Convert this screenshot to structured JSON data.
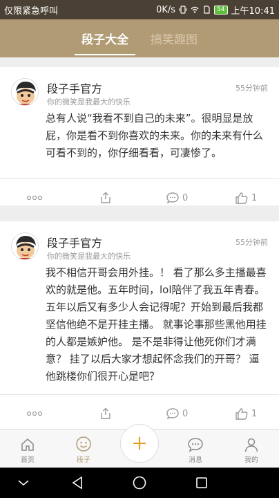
{
  "status_bar": {
    "left_text": "仅限紧急呼叫",
    "speed": "0K/s",
    "battery": "54",
    "time": "上午10:41"
  },
  "header": {
    "tabs": [
      {
        "label": "段子大全",
        "active": true
      },
      {
        "label": "搞笑趣图",
        "active": false
      }
    ]
  },
  "feed": {
    "posts": [
      {
        "author": "段子手官方",
        "motto": "你的微笑是我最大的快乐",
        "time": "55分钟前",
        "content": "总有人说“我看不到自己的未来”。很明显是放屁，你是看不到你喜欢的未来。你的未来有什么可看不到的，你仔细看看，可凄惨了。",
        "comments": "0",
        "likes": "1"
      },
      {
        "author": "段子手官方",
        "motto": "你的微笑是我最大的快乐",
        "time": "55分钟前",
        "content": "我不相信开哥会用外挂。！ 看了那么多主播最喜欢的就是他。五年时间，lol陪伴了我五年青春。五年以后又有多少人会记得呢？开始到最后我都坚信他绝不是开挂主播。 就事论事那些黑他用挂的人都是嫉妒他。 是不是非得让他死你们才满意？ 挂了以后大家才想起怀念我们的开哥？ 逼他跳楼你们很开心是吧？",
        "comments": "0",
        "likes": "1"
      }
    ]
  },
  "bottom_nav": {
    "items": [
      {
        "label": "首页",
        "icon": "home-icon",
        "active": false
      },
      {
        "label": "段子",
        "icon": "smile-icon",
        "active": true
      },
      {
        "label": "消息",
        "icon": "message-icon",
        "active": false
      },
      {
        "label": "我的",
        "icon": "user-icon",
        "active": false
      }
    ],
    "fab_icon": "plus-icon"
  },
  "colors": {
    "header_bg": "#b19b75",
    "status_bg": "#4a4033",
    "accent": "#b19b75",
    "battery_green": "#5cc03a"
  }
}
